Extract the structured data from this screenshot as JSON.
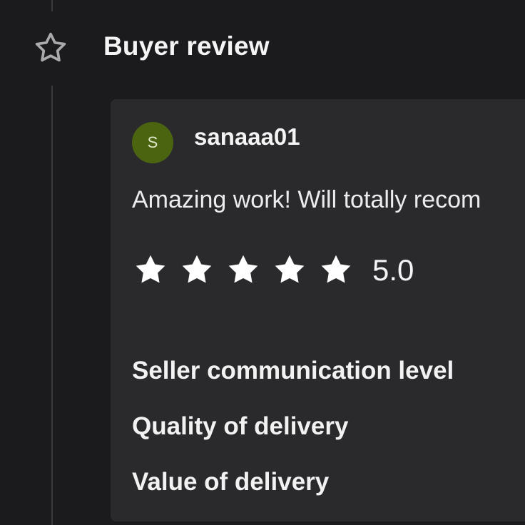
{
  "section": {
    "title": "Buyer review",
    "icon": "star-outline-icon"
  },
  "review": {
    "avatar_initial": "S",
    "avatar_color": "#4b6410",
    "username": "sanaaa01",
    "text": "Amazing work! Will totally recom",
    "rating": 5,
    "rating_label": "5.0",
    "star_icon": "star-filled-icon",
    "criteria": [
      {
        "label": "Seller communication level"
      },
      {
        "label": "Quality of delivery"
      },
      {
        "label": "Value of delivery"
      }
    ]
  },
  "colors": {
    "background": "#1b1b1d",
    "card": "#2a2a2d",
    "text": "#f4f4f5"
  }
}
